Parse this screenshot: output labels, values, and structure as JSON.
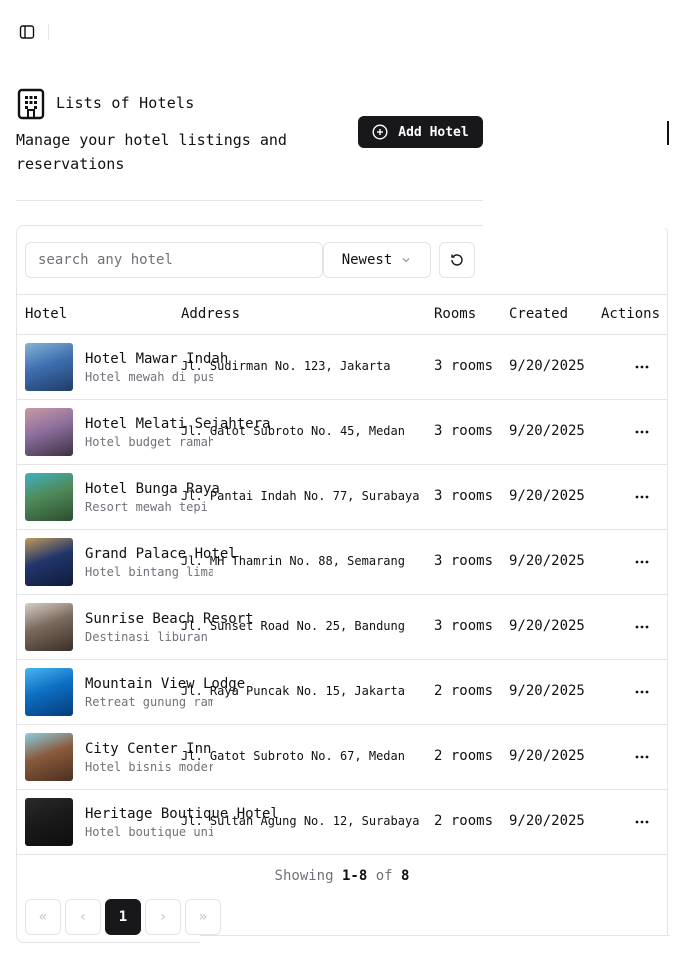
{
  "header": {
    "title": "Lists of Hotels",
    "subtitle": "Manage your hotel listings and reservations",
    "add_button_label": "Add Hotel"
  },
  "toolbar": {
    "search_placeholder": "search any hotel",
    "sort_value": "Newest"
  },
  "table": {
    "columns": [
      "Hotel",
      "Address",
      "Rooms",
      "Created",
      "Actions"
    ],
    "rows": [
      {
        "name": "Hotel Mawar Indah",
        "description": "Hotel mewah di pusat",
        "address": "Jl. Sudirman No. 123, Jakarta",
        "rooms": "3 rooms",
        "created": "9/20/2025",
        "thumb": [
          "#3f6fb0",
          "#86b3d8",
          "#1f3c66"
        ]
      },
      {
        "name": "Hotel Melati Sejahtera",
        "description": "Hotel budget ramah",
        "address": "Jl. Gatot Subroto No. 45, Medan",
        "rooms": "3 rooms",
        "created": "9/20/2025",
        "thumb": [
          "#8d6f9e",
          "#c99aa3",
          "#3d3140"
        ]
      },
      {
        "name": "Hotel Bunga Raya",
        "description": "Resort mewah tepi",
        "address": "Jl. Pantai Indah No. 77, Surabaya",
        "rooms": "3 rooms",
        "created": "9/20/2025",
        "thumb": [
          "#4f8a5a",
          "#3fb2c0",
          "#2d4d2e"
        ]
      },
      {
        "name": "Grand Palace Hotel",
        "description": "Hotel bintang lima",
        "address": "Jl. MH Thamrin No. 88, Semarang",
        "rooms": "3 rooms",
        "created": "9/20/2025",
        "thumb": [
          "#22366b",
          "#c09a5c",
          "#0f1b3a"
        ]
      },
      {
        "name": "Sunrise Beach Resort",
        "description": "Destinasi liburan",
        "address": "Jl. Sunset Road No. 25, Bandung",
        "rooms": "3 rooms",
        "created": "9/20/2025",
        "thumb": [
          "#7a6a5d",
          "#d8cfc6",
          "#3a2f28"
        ]
      },
      {
        "name": "Mountain View Lodge",
        "description": "Retreat gunung ramah",
        "address": "Jl. Raya Puncak No. 15, Jakarta",
        "rooms": "2 rooms",
        "created": "9/20/2025",
        "thumb": [
          "#0d6fc4",
          "#49b6ef",
          "#053c7a"
        ]
      },
      {
        "name": "City Center Inn",
        "description": "Hotel bisnis modern",
        "address": "Jl. Gatot Subroto No. 67, Medan",
        "rooms": "2 rooms",
        "created": "9/20/2025",
        "thumb": [
          "#8a5a3c",
          "#8ad0e0",
          "#4a3020"
        ]
      },
      {
        "name": "Heritage Boutique Hotel",
        "description": "Hotel boutique unik",
        "address": "Jl. Sultan Agung No. 12, Surabaya",
        "rooms": "2 rooms",
        "created": "9/20/2025",
        "thumb": [
          "#1a1a1a",
          "#2a2a2a",
          "#0e0e0e"
        ]
      }
    ]
  },
  "footer": {
    "showing_prefix": "Showing",
    "range": "1-8",
    "of_text": "of",
    "total": "8",
    "pagination": {
      "first": "«",
      "prev": "‹",
      "current": "1",
      "next": "›",
      "last": "»"
    }
  },
  "icons": {
    "sidebar_toggle": "sidebar-icon",
    "header": "building-icon",
    "add": "plus-circle-icon",
    "sort": "chevron-down-icon",
    "refresh": "refresh-icon",
    "row_actions": "more-horizontal-icon"
  }
}
